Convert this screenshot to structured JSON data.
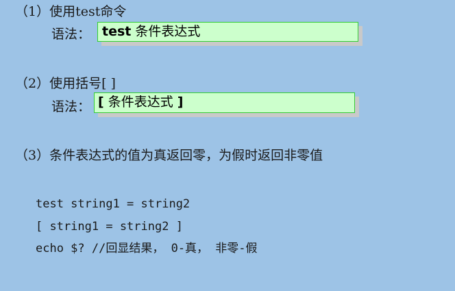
{
  "items": [
    {
      "heading": "（1）使用test命令",
      "syntax_label": "语法：",
      "syntax_keyword": "test",
      "syntax_rest": " 条件表达式"
    },
    {
      "heading": "（2）使用括号[ ]",
      "syntax_label": "语法：",
      "bracket_open": "[",
      "syntax_rest": " 条件表达式 ",
      "bracket_close": "]"
    },
    {
      "heading": "（3）条件表达式的值为真返回零，为假时返回非零值"
    }
  ],
  "code_lines": [
    "test string1 = string2",
    "[ string1 = string2 ]",
    "echo $? //回显结果， 0-真， 非零-假"
  ]
}
